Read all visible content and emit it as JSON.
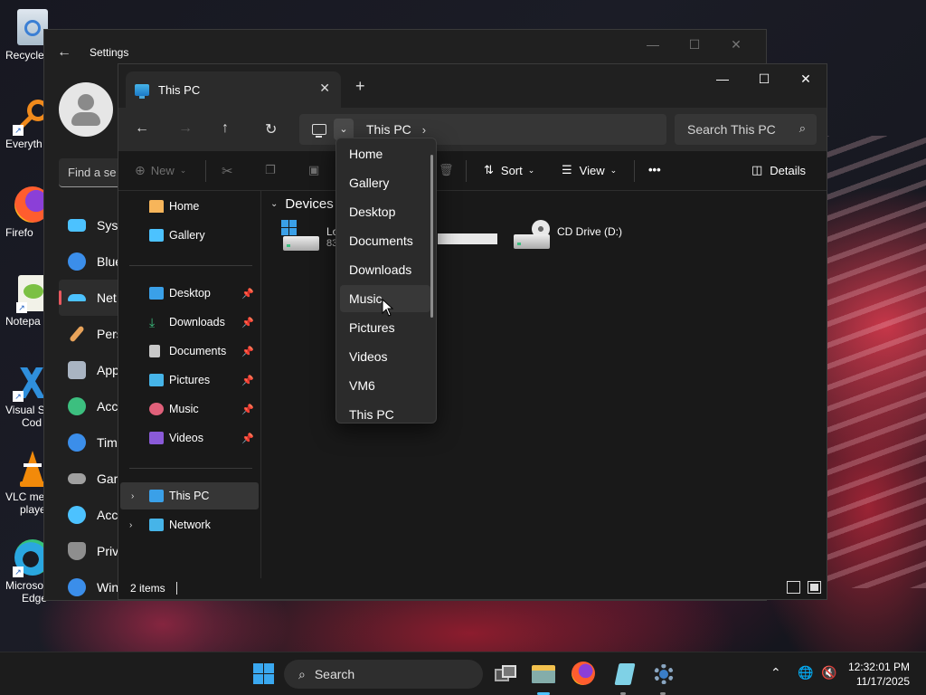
{
  "desktop": {
    "icons": [
      {
        "label": "Recycle",
        "icon": "recycle-bin-icon"
      },
      {
        "label": "Everyth",
        "icon": "everything-search-icon"
      },
      {
        "label": "Firefo",
        "icon": "firefox-icon"
      },
      {
        "label": "Notepa",
        "icon": "notepad-plus-plus-icon"
      },
      {
        "label": "Visual St",
        "label2": "Cod",
        "icon": "vscode-icon"
      },
      {
        "label": "VLC me",
        "label2": "playe",
        "icon": "vlc-icon"
      },
      {
        "label": "Microso",
        "label2": "Edge",
        "icon": "edge-icon"
      }
    ]
  },
  "settings": {
    "title": "Settings",
    "search_placeholder": "Find a se",
    "nav": [
      {
        "label": "Syst",
        "icon": "system-icon",
        "color": "#4cc2ff"
      },
      {
        "label": "Blue",
        "icon": "bluetooth-icon",
        "color": "#3b8eea"
      },
      {
        "label": "Net",
        "icon": "network-icon",
        "color": "#4cc2ff",
        "active": true
      },
      {
        "label": "Pers",
        "icon": "personalization-icon",
        "color": "#e8a35a"
      },
      {
        "label": "App",
        "icon": "apps-icon",
        "color": "#a9b4c2"
      },
      {
        "label": "Acc",
        "icon": "accounts-icon",
        "color": "#3cbf7f"
      },
      {
        "label": "Tim",
        "icon": "time-language-icon",
        "color": "#3b8eea"
      },
      {
        "label": "Gar",
        "icon": "gaming-icon",
        "color": "#a0a0a0"
      },
      {
        "label": "Acc",
        "icon": "accessibility-icon",
        "color": "#4cc2ff"
      },
      {
        "label": "Priv",
        "icon": "privacy-icon",
        "color": "#8e8e8e"
      },
      {
        "label": "Win",
        "icon": "windows-update-icon",
        "color": "#3b8eea"
      }
    ]
  },
  "explorer": {
    "tab_title": "This PC",
    "breadcrumb": "This PC",
    "search_placeholder": "Search This PC",
    "toolbar": {
      "new": "New",
      "sort": "Sort",
      "view": "View",
      "more": "•••",
      "details": "Details"
    },
    "nav": {
      "home": "Home",
      "gallery": "Gallery",
      "desktop": "Desktop",
      "downloads": "Downloads",
      "documents": "Documents",
      "pictures": "Pictures",
      "music": "Music",
      "videos": "Videos",
      "this_pc": "This PC",
      "network": "Network"
    },
    "group_header": "Devices a",
    "drives": [
      {
        "name": "Lo",
        "sub": "83",
        "icon": "local-disk-icon"
      },
      {
        "name": "CD Drive (D:)",
        "icon": "cd-drive-icon"
      }
    ],
    "status": "2 items"
  },
  "dropdown": {
    "items": [
      "Home",
      "Gallery",
      "Desktop",
      "Documents",
      "Downloads",
      "Music",
      "Pictures",
      "Videos",
      "VM6",
      "This PC"
    ],
    "hovered": "Music"
  },
  "taskbar": {
    "search": "Search",
    "time": "12:32:01 PM",
    "date": "11/17/2025"
  },
  "colors": {
    "accent": "#4cc2ff",
    "settings_active_indicator": "#e8585f"
  }
}
